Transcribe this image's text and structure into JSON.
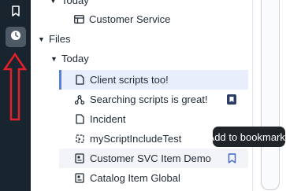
{
  "tree": {
    "partial_group": {
      "label": "Today"
    },
    "customer_service": {
      "label": "Customer Service"
    },
    "files": {
      "label": "Files"
    },
    "today": {
      "label": "Today"
    },
    "items": [
      {
        "label": "Client scripts too!",
        "icon": "document-icon"
      },
      {
        "label": "Searching scripts is great!",
        "icon": "workflow-icon"
      },
      {
        "label": "Incident",
        "icon": "document-icon"
      },
      {
        "label": "myScriptIncludeTest",
        "icon": "script-icon"
      },
      {
        "label": "Customer SVC Item Demo",
        "icon": "catalog-icon"
      },
      {
        "label": "Catalog Item Global",
        "icon": "catalog-icon"
      }
    ]
  },
  "tooltip": {
    "text": "Add to bookmarks"
  },
  "colors": {
    "accent": "#5b7fd6",
    "rail": "#18252f",
    "annotation": "#e5202a",
    "bookmark_fill": "#2c3e63"
  }
}
